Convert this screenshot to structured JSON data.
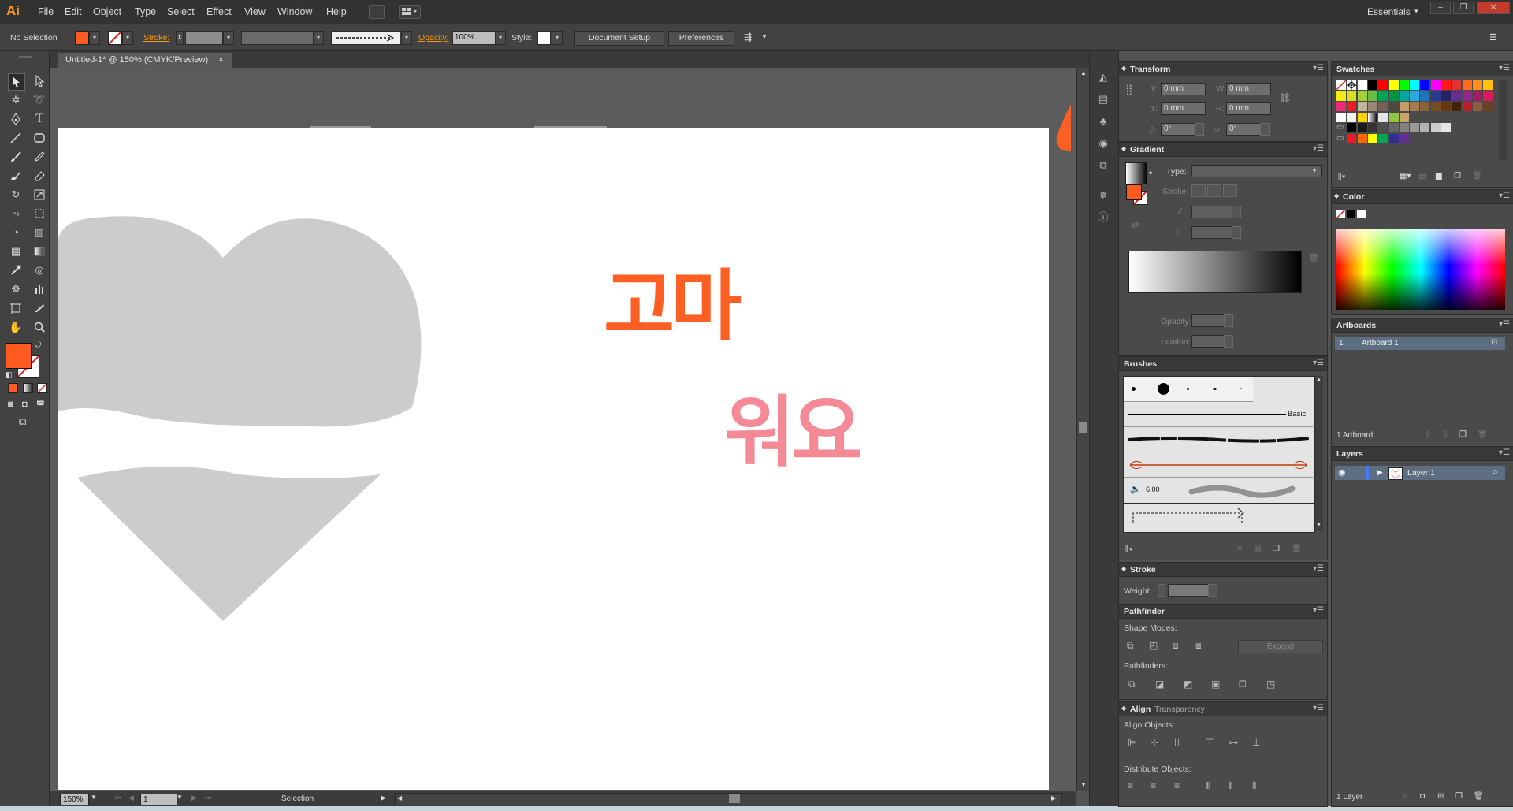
{
  "app": {
    "logo": "Ai",
    "menu": [
      "File",
      "Edit",
      "Object",
      "Type",
      "Select",
      "Effect",
      "View",
      "Window",
      "Help"
    ],
    "workspace": "Essentials"
  },
  "control_bar": {
    "selection_state": "No Selection",
    "stroke_label": "Stroke:",
    "opacity_label": "Opacity:",
    "opacity_value": "100%",
    "style_label": "Style:",
    "document_setup": "Document Setup",
    "preferences": "Preferences",
    "fill_color": "#ff5a1f"
  },
  "document": {
    "tab_title": "Untitled-1* @ 150% (CMYK/Preview)",
    "text_line1": "고마",
    "text_line2": "워요",
    "text1_color": "#fc5f24",
    "text2_color": "#f48a95",
    "heart_color": "#cccccc"
  },
  "status": {
    "zoom": "150%",
    "artboard_num": "1",
    "tool_name": "Selection"
  },
  "panels": {
    "transform": {
      "title": "Transform",
      "x_label": "X:",
      "x": "0 mm",
      "y_label": "Y:",
      "y": "0 mm",
      "w_label": "W:",
      "w": "0 mm",
      "h_label": "H:",
      "h": "0 mm",
      "rot": "0°",
      "shear": "0°"
    },
    "gradient": {
      "title": "Gradient",
      "type_label": "Type:",
      "stroke_label": "Stroke:",
      "opacity_label": "Opacity:",
      "location_label": "Location:"
    },
    "brushes": {
      "title": "Brushes",
      "basic_label": "Basic",
      "size_value": "6.00"
    },
    "stroke": {
      "title": "Stroke",
      "weight_label": "Weight:"
    },
    "pathfinder": {
      "title": "Pathfinder",
      "shape_modes": "Shape Modes:",
      "expand": "Expand",
      "pathfinders": "Pathfinders:"
    },
    "align": {
      "title": "Align",
      "tab2": "Transparency",
      "align_objects": "Align Objects:",
      "distribute_objects": "Distribute Objects:"
    },
    "swatches": {
      "title": "Swatches"
    },
    "color": {
      "title": "Color"
    },
    "artboards": {
      "title": "Artboards",
      "row_num": "1",
      "row_name": "Artboard 1",
      "footer": "1 Artboard"
    },
    "layers": {
      "title": "Layers",
      "layer_name": "Layer 1",
      "footer": "1 Layer"
    }
  }
}
